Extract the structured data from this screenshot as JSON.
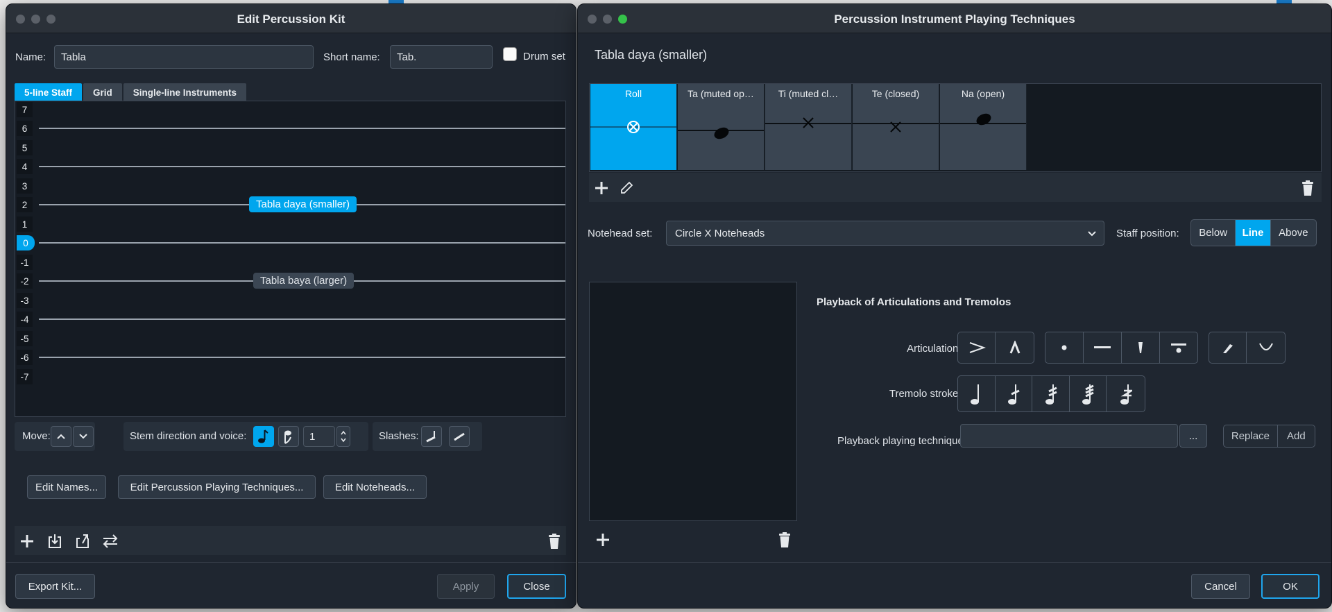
{
  "left_window": {
    "title": "Edit Percussion Kit",
    "name_label": "Name:",
    "name_value": "Tabla",
    "short_name_label": "Short name:",
    "short_name_value": "Tab.",
    "drum_set_label": "Drum set",
    "drum_set_checked": false,
    "tabs": [
      "5-line Staff",
      "Grid",
      "Single-line Instruments"
    ],
    "active_tab": "5-line Staff",
    "staff_positions": [
      "7",
      "6",
      "5",
      "4",
      "3",
      "2",
      "1",
      "0",
      "-1",
      "-2",
      "-3",
      "-4",
      "-5",
      "-6",
      "-7"
    ],
    "selected_position": "0",
    "instruments": [
      {
        "label": "Tabla daya (smaller)",
        "position": "2",
        "selected": true
      },
      {
        "label": "Tabla baya (larger)",
        "position": "-2",
        "selected": false
      }
    ],
    "move_label": "Move:",
    "stem_label": "Stem direction and voice:",
    "voice_value": "1",
    "slashes_label": "Slashes:",
    "edit_names_button": "Edit Names...",
    "edit_techniques_button": "Edit Percussion Playing Techniques...",
    "edit_noteheads_button": "Edit Noteheads...",
    "export_button": "Export Kit...",
    "apply_button": "Apply",
    "close_button": "Close"
  },
  "right_window": {
    "title": "Percussion Instrument Playing Techniques",
    "instrument_name": "Tabla daya (smaller)",
    "techniques": [
      {
        "label": "Roll",
        "notehead": "circle-x",
        "active": true
      },
      {
        "label": "Ta (muted op…",
        "notehead": "filled-below",
        "active": false
      },
      {
        "label": "Ti (muted cl…",
        "notehead": "x",
        "active": false
      },
      {
        "label": "Te (closed)",
        "notehead": "x-below",
        "active": false
      },
      {
        "label": "Na (open)",
        "notehead": "filled",
        "active": false
      }
    ],
    "notehead_set_label": "Notehead set:",
    "notehead_set_value": "Circle X Noteheads",
    "staff_position_label": "Staff position:",
    "staff_position_options": [
      "Below",
      "Line",
      "Above"
    ],
    "staff_position_selected": "Line",
    "playback_heading": "Playback of Articulations and Tremolos",
    "articulations_label": "Articulations:",
    "tremolo_label": "Tremolo strokes:",
    "playback_technique_label": "Playback playing technique:",
    "playback_technique_value": "",
    "ellipsis_button": "...",
    "replace_button": "Replace",
    "add_button": "Add",
    "cancel_button": "Cancel",
    "ok_button": "OK"
  },
  "colors": {
    "accent": "#00a6ee",
    "window_bg": "#1f2630",
    "panel_bg": "#141a21"
  }
}
